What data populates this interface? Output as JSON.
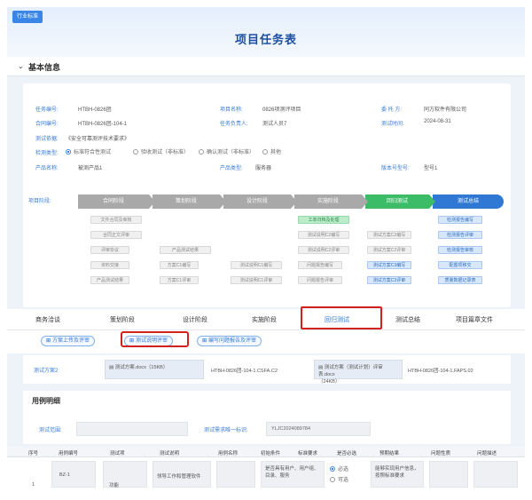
{
  "header": {
    "logo": "行业标准",
    "title": "项目任务表"
  },
  "basic_section": {
    "label": "基本信息"
  },
  "fields": {
    "task_no": {
      "label": "任务编号:",
      "value": "HTBH-0826团"
    },
    "project_name": {
      "label": "项目名称:",
      "value": "0826项测评项目"
    },
    "client": {
      "label": "委 托 方:",
      "value": "同方软件有限公司"
    },
    "contract_no": {
      "label": "合同编号:",
      "value": "HTBH-0826团-104-1"
    },
    "task_lead": {
      "label": "任务负责人:",
      "value": "测试人员7"
    },
    "test_date": {
      "label": "测试时间:",
      "value": "2024-08-31"
    },
    "test_basis": {
      "label": "测试依据:",
      "value": "《安全可靠测评技术要求》"
    },
    "test_type": {
      "label": "检测类型:",
      "options": [
        "标准符合性测试",
        "验收测试（非标准）",
        "确认测试（非标准）",
        "其他"
      ],
      "selected": 0
    },
    "product_name": {
      "label": "产品名称:",
      "value": "被测产品1"
    },
    "product_type": {
      "label": "产品类型:",
      "value": "服务器"
    },
    "version": {
      "label": "版本号型号:",
      "value": "型号1"
    }
  },
  "stages": {
    "label": "项目阶段:",
    "items": [
      "合同阶段",
      "策划阶段",
      "设计阶段",
      "实施阶段",
      "回归测试",
      "测试总结"
    ]
  },
  "chips": {
    "c1": [
      "文件合同及审核",
      "合同正文评审",
      "评审协议"
    ],
    "c2": [
      "资料交接",
      "方案C1编写",
      "方案C1评审"
    ],
    "c3": [
      "产品测试结果",
      "测试说明C1编写",
      "测试说明C1评审"
    ],
    "c4": [
      "工单归档及处理",
      "测试说明C2编写",
      "测试说明C2评审",
      "问题报告编写",
      "问题报告评审"
    ],
    "c5": [
      "测试方案C2编写",
      "测试方案C2评审",
      "测试方案C3编写",
      "测试方案C3评审"
    ],
    "c6": [
      "检测报告编写",
      "检测报告评审",
      "检测报告审核",
      "配置项移交",
      "质量数据记录表"
    ]
  },
  "tabs": [
    "商务洽谈",
    "策划阶段",
    "设计阶段",
    "实施阶段",
    "回归测试",
    "测试总结",
    "项目篇章文件"
  ],
  "buttons": {
    "plan": "方案上传及评审",
    "review": "测试说明评审",
    "record": "编写问题报告及评审"
  },
  "doc": {
    "label": "测试方案2",
    "file1": "测试方案.docx（15KB）",
    "id1": "HTBH-0826团-104-1.CSFA.C2",
    "file2": "测试方案（测试计划）评审表.docx",
    "file2_size": "（24KB）",
    "id2": "HTBH-0826团-104-1.FAPS.02"
  },
  "use_case": {
    "title": "用例明细",
    "field1_label": "测试范围:",
    "field2_label": "测试需求唯一标识:",
    "field2_value": "YLJC2024089784"
  },
  "table": {
    "headers": [
      "序号",
      "用例编号",
      "测试项",
      "测试说明",
      "用例名称",
      "初始条件",
      "标准要求",
      "是否必选",
      "预期结果",
      "问题性质",
      "问题描述"
    ],
    "row": {
      "seq": "1",
      "case_id": "BZ-1",
      "test_item": "功能",
      "test_desc": "领导工作和管理软件",
      "req": "是否具有用户、用户组、目录、服务",
      "opt1": "必选",
      "opt2": "可选",
      "expected": "能够实现用户信息，按照标准要求"
    }
  }
}
